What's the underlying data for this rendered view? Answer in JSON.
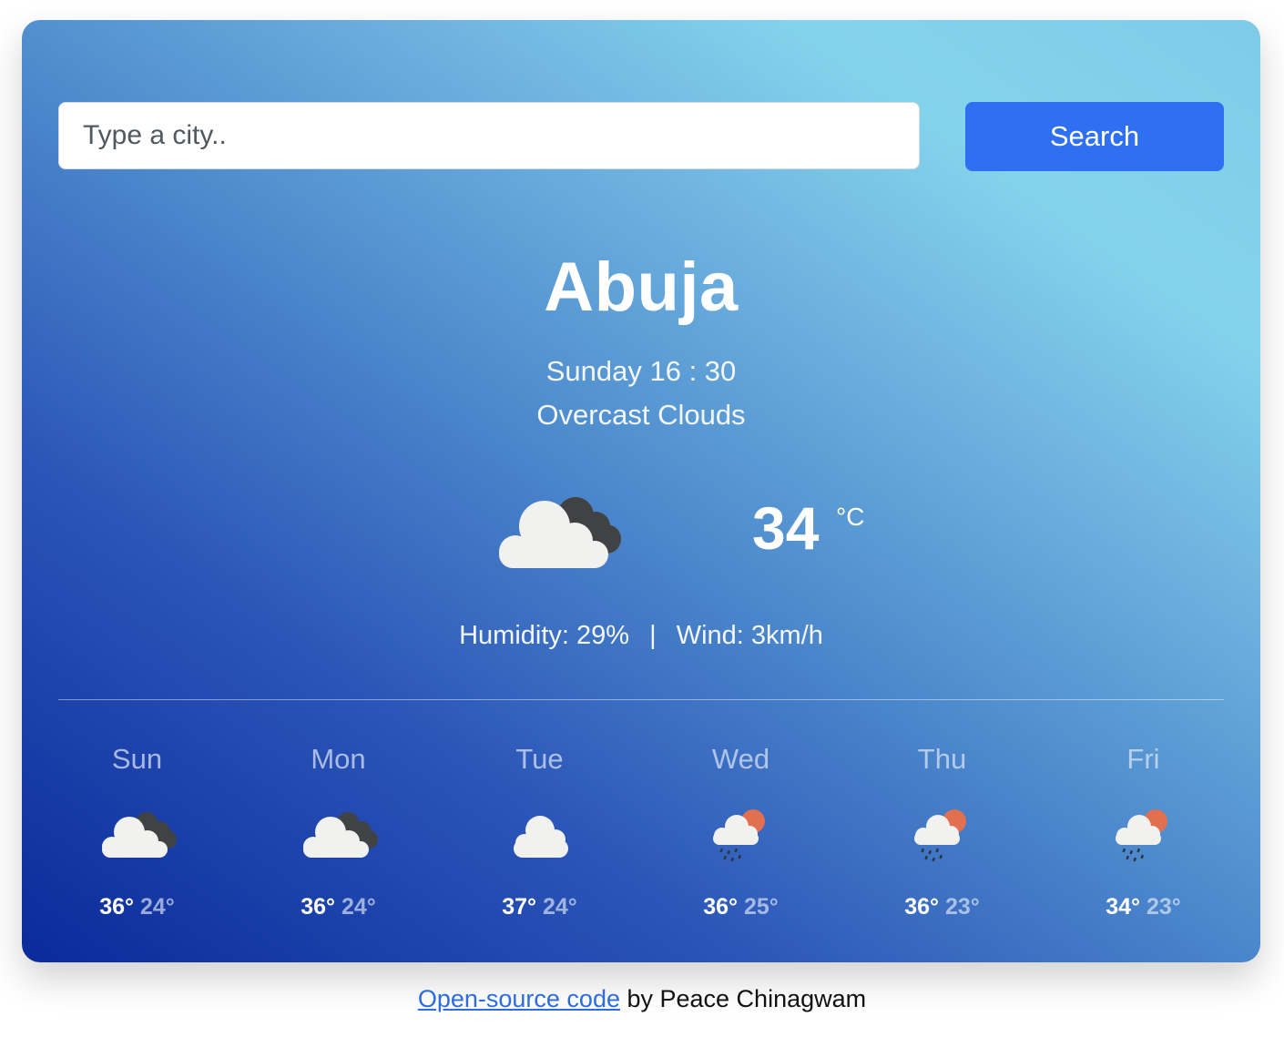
{
  "search": {
    "placeholder": "Type a city..",
    "value": "",
    "button_label": "Search"
  },
  "current": {
    "city": "Abuja",
    "datetime": "Sunday 16 : 30",
    "description": "Overcast Clouds",
    "icon": "overcast-clouds-icon",
    "temperature": "34",
    "unit": "°C",
    "humidity_text": "Humidity: 29%",
    "separator": "|",
    "wind_text": "Wind: 3km/h"
  },
  "forecast": [
    {
      "day": "Sun",
      "icon": "broken-clouds-icon",
      "max": "36°",
      "min": "24°"
    },
    {
      "day": "Mon",
      "icon": "broken-clouds-icon",
      "max": "36°",
      "min": "24°"
    },
    {
      "day": "Tue",
      "icon": "cloud-icon",
      "max": "37°",
      "min": "24°"
    },
    {
      "day": "Wed",
      "icon": "rain-sun-icon",
      "max": "36°",
      "min": "25°"
    },
    {
      "day": "Thu",
      "icon": "rain-sun-icon",
      "max": "36°",
      "min": "23°"
    },
    {
      "day": "Fri",
      "icon": "rain-sun-icon",
      "max": "34°",
      "min": "23°"
    }
  ],
  "footer": {
    "link_text": "Open-source code",
    "suffix": " by Peace Chinagwam"
  },
  "colors": {
    "accent": "#2f6ff1",
    "gradient_dark": "#0a2a9a",
    "gradient_light": "#84d3ec",
    "link": "#2d6ce0"
  }
}
